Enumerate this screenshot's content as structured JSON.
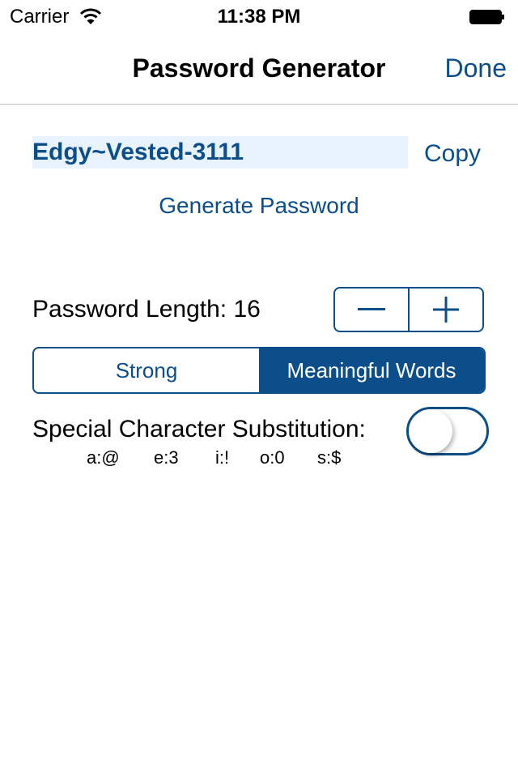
{
  "status_bar": {
    "carrier": "Carrier",
    "time": "11:38 PM",
    "wifi_icon": "wifi-icon",
    "battery_icon": "battery-icon"
  },
  "nav": {
    "title": "Password Generator",
    "done_label": "Done"
  },
  "password": {
    "value": "Edgy~Vested-3111",
    "copy_label": "Copy",
    "generate_label": "Generate Password"
  },
  "length": {
    "label": "Password Length: 16",
    "value": 16,
    "decrement_icon": "minus-icon",
    "increment_icon": "plus-icon"
  },
  "mode": {
    "options": [
      "Strong",
      "Meaningful Words"
    ],
    "selected": "Meaningful Words"
  },
  "substitution": {
    "label": "Special Character Substitution:",
    "enabled": false,
    "mappings": [
      "a:@",
      "e:3",
      "i:!",
      "o:0",
      "s:$"
    ]
  },
  "colors": {
    "accent": "#0b4e8a",
    "field_background": "#e8f3fd",
    "divider": "#bdbdbd"
  }
}
